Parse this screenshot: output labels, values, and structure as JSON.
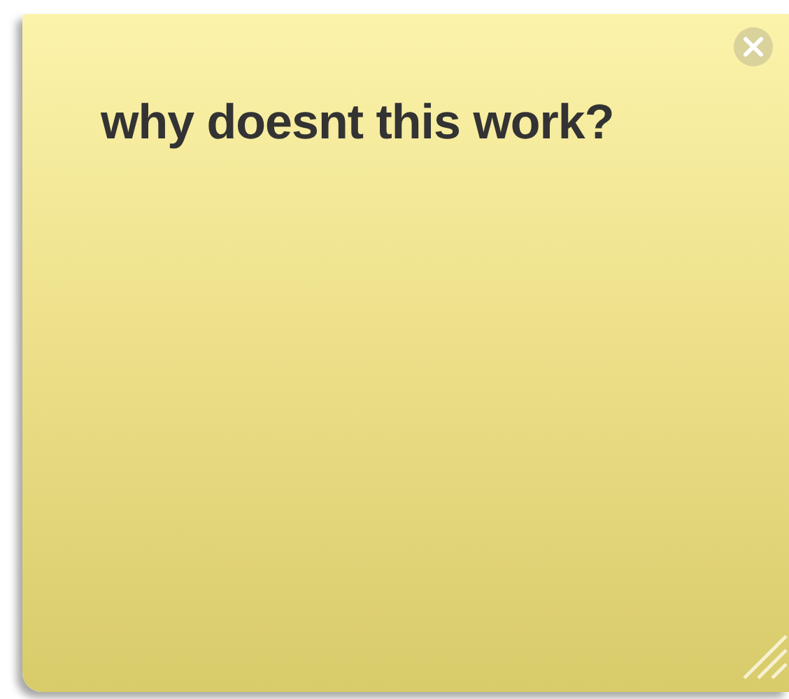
{
  "note": {
    "text": "why doesnt this work?"
  }
}
